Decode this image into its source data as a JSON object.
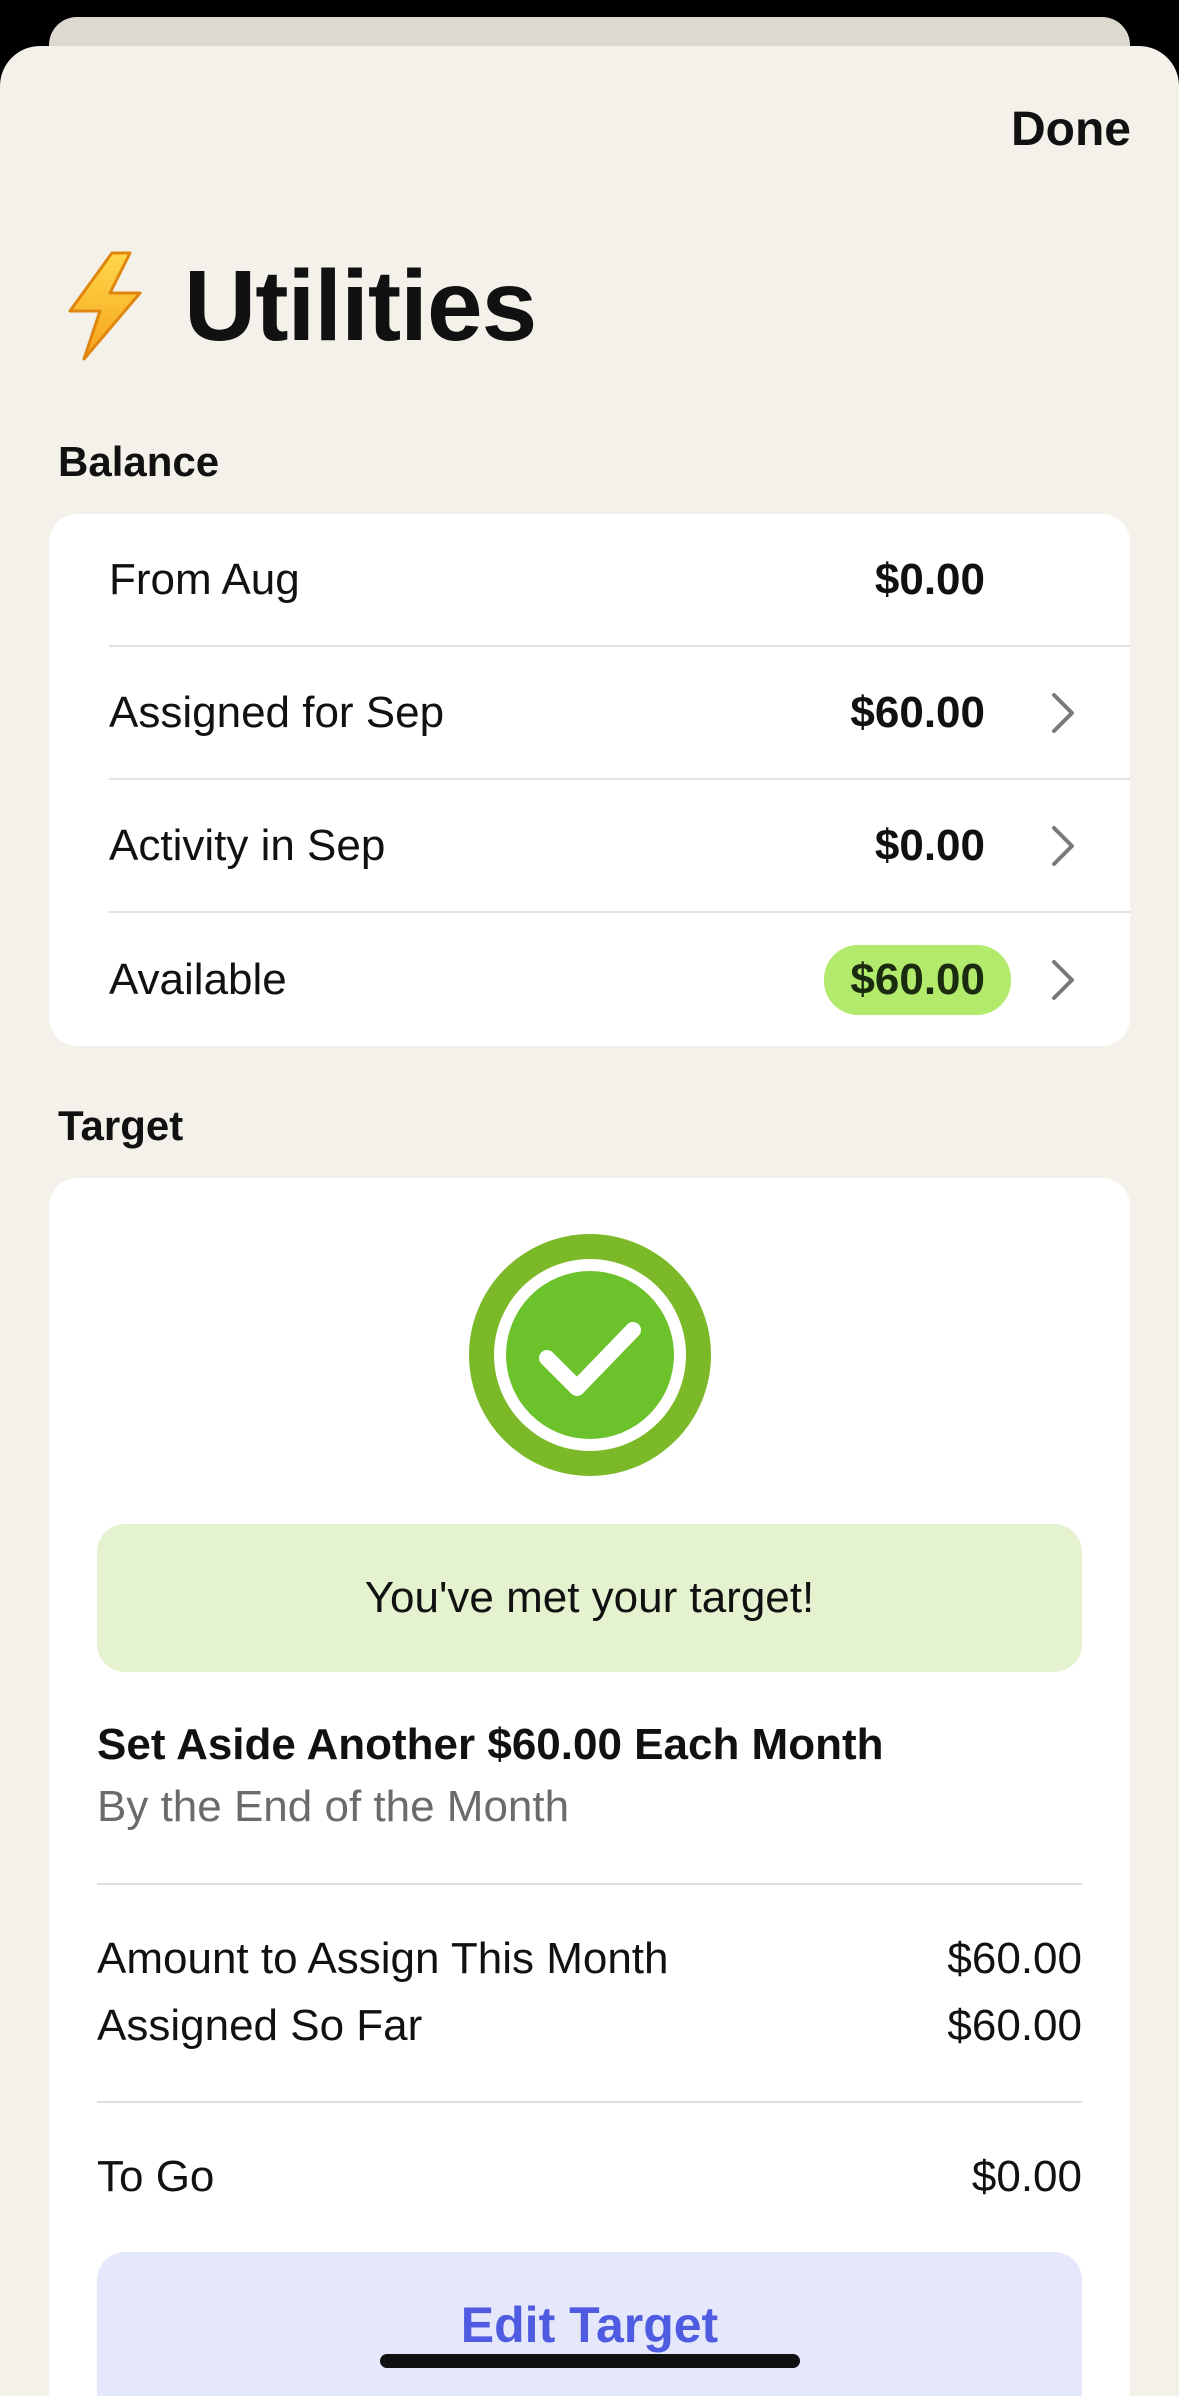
{
  "header": {
    "done_label": "Done",
    "title": "Utilities",
    "icon": "lightning-bolt-icon"
  },
  "balance": {
    "section_label": "Balance",
    "rows": [
      {
        "label": "From Aug",
        "value": "$0.00",
        "has_chevron": false
      },
      {
        "label": "Assigned for Sep",
        "value": "$60.00",
        "has_chevron": true
      },
      {
        "label": "Activity in Sep",
        "value": "$0.00",
        "has_chevron": true
      },
      {
        "label": "Available",
        "value": "$60.00",
        "has_chevron": true,
        "badge_color": "#b2ea6c"
      }
    ]
  },
  "target": {
    "section_label": "Target",
    "status_icon": "check-circle-icon",
    "status_message": "You've met your target!",
    "heading": "Set Aside Another $60.00 Each Month",
    "subheading": "By the End of the Month",
    "amount_to_assign": {
      "label": "Amount to Assign This Month",
      "value": "$60.00"
    },
    "assigned_so_far": {
      "label": "Assigned So Far",
      "value": "$60.00"
    },
    "to_go": {
      "label": "To Go",
      "value": "$0.00"
    },
    "edit_label": "Edit Target"
  },
  "colors": {
    "accent_green": "#6cbf2a",
    "accent_blue": "#4f5be0",
    "background": "#f3f1ea"
  }
}
